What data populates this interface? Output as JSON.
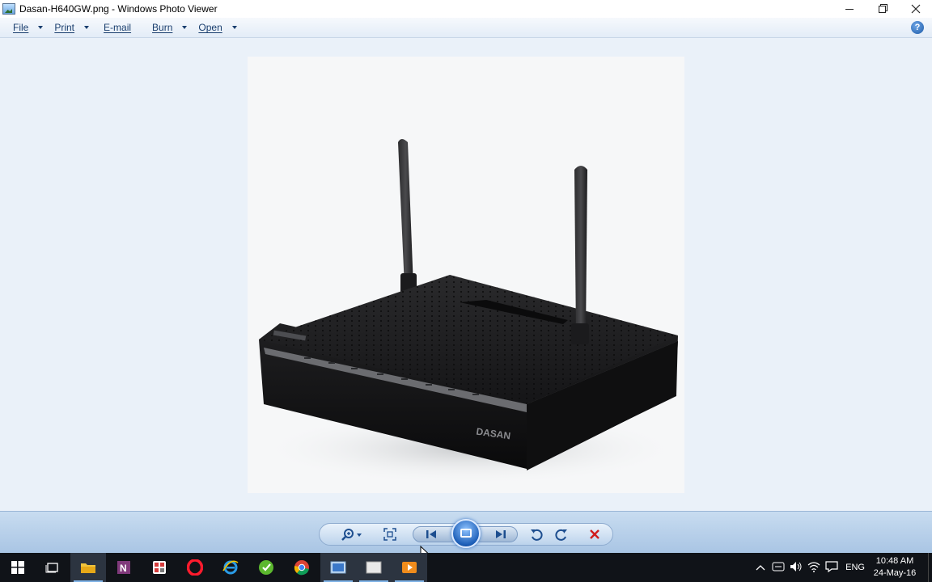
{
  "window": {
    "title": "Dasan-H640GW.png - Windows Photo Viewer"
  },
  "menu": {
    "file": "File",
    "print": "Print",
    "email": "E-mail",
    "burn": "Burn",
    "open": "Open",
    "help": "?"
  },
  "photo": {
    "brand_label": "DASAN"
  },
  "tray": {
    "lang": "ENG",
    "time": "10:48 AM",
    "date": "24-May-16"
  },
  "colors": {
    "accent": "#1d5fb8",
    "delete": "#d01c1c",
    "taskbar": "#101318"
  }
}
